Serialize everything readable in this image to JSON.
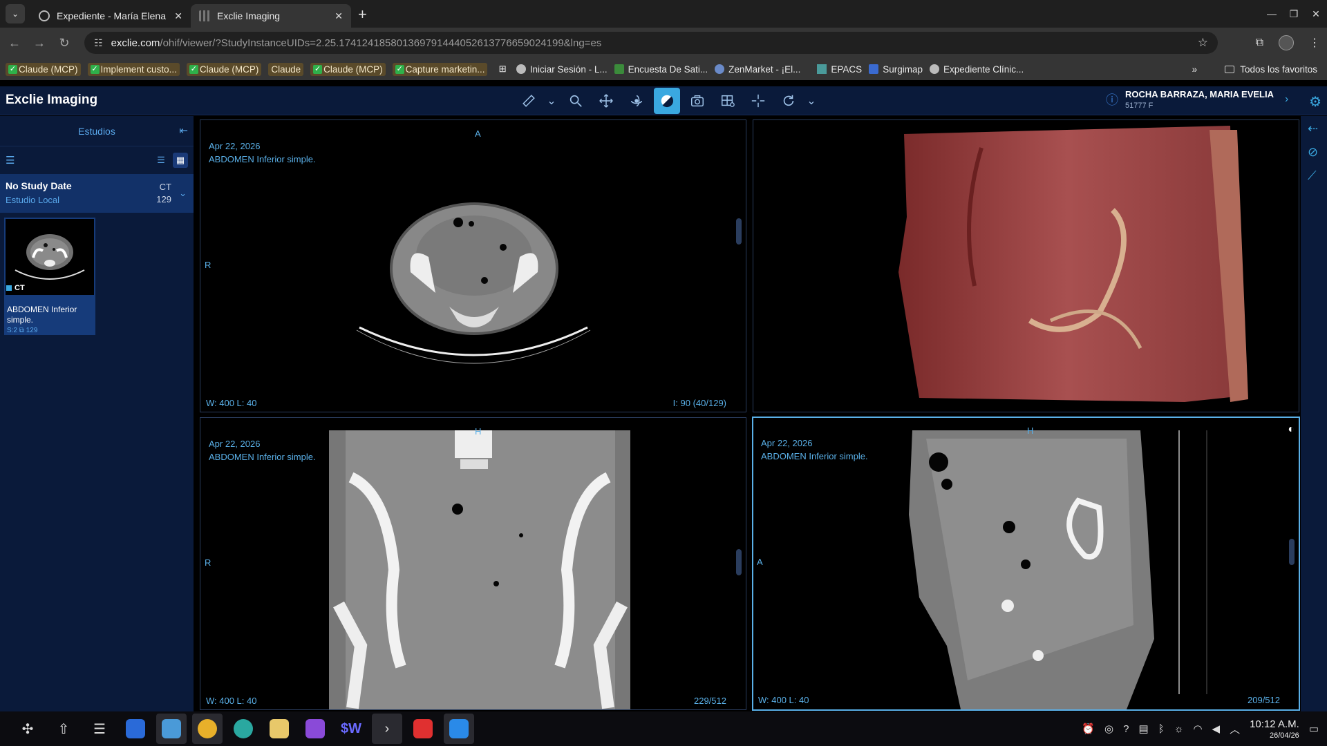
{
  "browser": {
    "tabs": [
      {
        "title": "Expediente - María Elena G",
        "active": false
      },
      {
        "title": "Exclie Imaging",
        "active": true
      }
    ],
    "url_host": "exclie.com",
    "url_path": "/ohif/viewer/?StudyInstanceUIDs=2.25.174124185801369791444052613776659024199&lng=es",
    "bookmarks": [
      {
        "label": "Claude (MCP)",
        "check": true,
        "tag": true
      },
      {
        "label": "Implement custo...",
        "check": true,
        "tag": true
      },
      {
        "label": "Claude (MCP)",
        "check": true,
        "tag": true
      },
      {
        "label": "Claude",
        "check": false,
        "tag": true
      },
      {
        "label": "Claude (MCP)",
        "check": true,
        "tag": true
      },
      {
        "label": "Capture marketin...",
        "check": true,
        "tag": true
      },
      {
        "label": "Iniciar Sesión - L...",
        "check": false,
        "tag": false
      },
      {
        "label": "Encuesta De Sati...",
        "check": false,
        "tag": false
      },
      {
        "label": "ZenMarket - ¡El...",
        "check": false,
        "tag": false
      },
      {
        "label": "EPACS",
        "check": false,
        "tag": false
      },
      {
        "label": "Surgimap",
        "check": false,
        "tag": false
      },
      {
        "label": "Expediente Clínic...",
        "check": false,
        "tag": false
      }
    ],
    "more_bookmarks": "»",
    "all_favorites": "Todos los favoritos"
  },
  "app": {
    "title": "Exclie Imaging",
    "patient_name": "ROCHA BARRAZA, MARIA EVELIA",
    "patient_sub": "51777  F"
  },
  "left_panel": {
    "header": "Estudios",
    "study": {
      "date": "No Study Date",
      "location": "Estudio Local",
      "modality": "CT",
      "count": "129"
    },
    "series": {
      "modality": "CT",
      "description": "ABDOMEN Inferior simple.",
      "meta": "S:2  ⧉ 129"
    }
  },
  "viewports": {
    "axial": {
      "orient_top": "A",
      "orient_left": "R",
      "date": "Apr 22, 2026",
      "desc": "ABDOMEN Inferior simple.",
      "wl": "W: 400  L: 40",
      "index": "I: 90 (40/129)"
    },
    "coronal": {
      "orient_top": "H",
      "orient_left": "R",
      "date": "Apr 22, 2026",
      "desc": "ABDOMEN Inferior simple.",
      "wl": "W: 400  L: 40",
      "index": "229/512"
    },
    "sagittal": {
      "orient_top": "H",
      "orient_left": "A",
      "date": "Apr 22, 2026",
      "desc": "ABDOMEN Inferior simple.",
      "wl": "W: 400  L: 40",
      "index": "209/512"
    }
  },
  "clock": {
    "time": "10:12 A.M.",
    "date": "26/04/26"
  },
  "colors": {
    "accent": "#3aa8e0",
    "header_bg": "#0a1a3a",
    "overlay_text": "#5ab0e8"
  }
}
